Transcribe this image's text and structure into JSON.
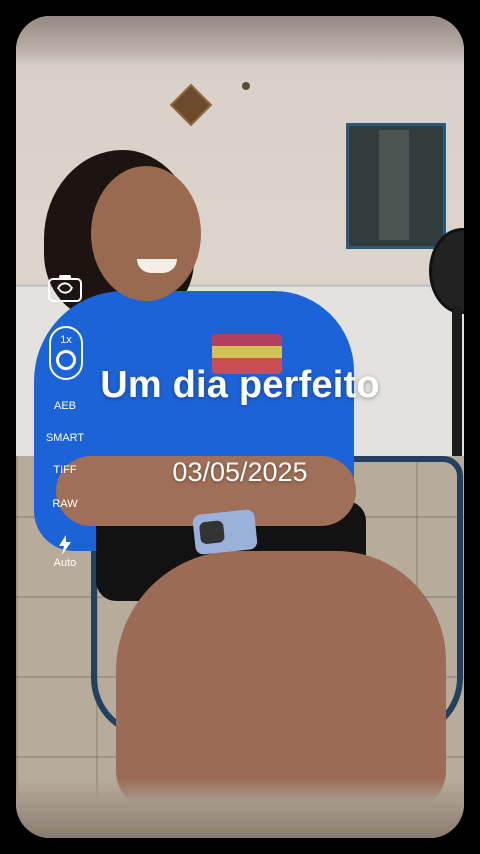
{
  "overlay": {
    "title": "Um dia perfeito",
    "date": "03/05/2025"
  },
  "camera_controls": {
    "switch_icon": "camera-switch-icon",
    "zoom_label": "1x",
    "modes": [
      "AEB",
      "SMART",
      "TIFF",
      "RAW"
    ],
    "flash_icon": "flash-icon",
    "flash_label": "Auto"
  },
  "colors": {
    "background": "#000000",
    "overlay_text": "#ffffff",
    "shirt": "#1d63d8"
  }
}
